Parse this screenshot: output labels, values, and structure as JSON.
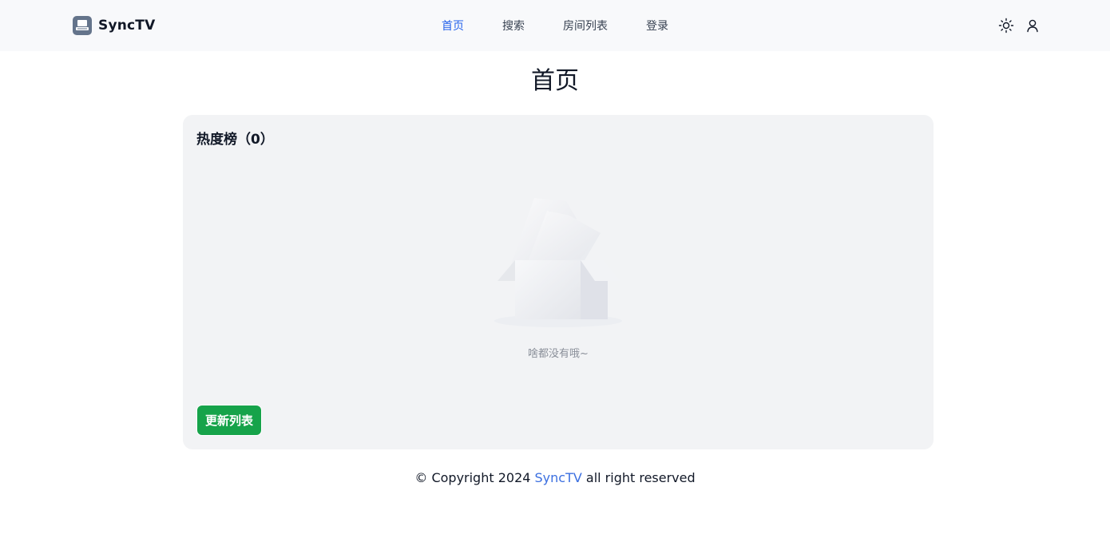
{
  "header": {
    "brand": "SyncTV",
    "nav": [
      {
        "label": "首页",
        "active": true
      },
      {
        "label": "搜索",
        "active": false
      },
      {
        "label": "房间列表",
        "active": false
      },
      {
        "label": "登录",
        "active": false
      }
    ],
    "icons": [
      "sun-icon",
      "user-icon"
    ]
  },
  "main": {
    "title": "首页",
    "hot_list": {
      "title": "热度榜（0）",
      "empty_text": "啥都没有哦~",
      "refresh_label": "更新列表"
    }
  },
  "footer": {
    "prefix": "© Copyright 2024 ",
    "link": "SyncTV",
    "suffix": " all right reserved"
  },
  "colors": {
    "accent": "#2563eb",
    "button": "#16a34a",
    "card_bg": "#f2f3f5",
    "link": "#3b6fe0"
  }
}
